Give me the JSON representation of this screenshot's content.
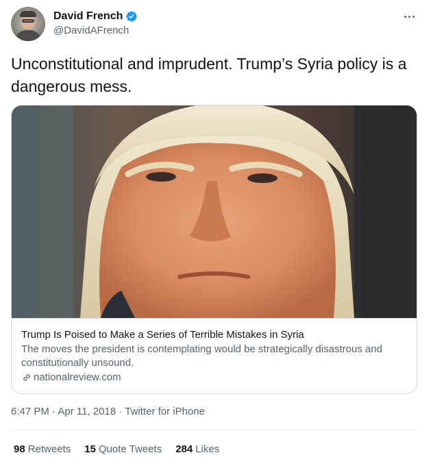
{
  "user": {
    "display_name": "David French",
    "handle": "@DavidAFrench",
    "verified_icon": "verified-badge-icon",
    "avatar_icon": "avatar-photo"
  },
  "tweet": {
    "text": "Unconstitutional and imprudent. Trump’s Syria policy is a dangerous mess."
  },
  "card": {
    "title": "Trump Is Poised to Make a Series of Terrible Mistakes in Syria",
    "description": "The moves the president is contemplating would be strategically disastrous and constitutionally unsound.",
    "domain": "nationalreview.com",
    "link_icon": "link-icon"
  },
  "meta": {
    "time": "6:47 PM",
    "date": "Apr 11, 2018",
    "source": "Twitter for iPhone",
    "separator": "·"
  },
  "stats": {
    "retweets_count": "98",
    "retweets_label": "Retweets",
    "quote_count": "15",
    "quote_label": "Quote Tweets",
    "likes_count": "284",
    "likes_label": "Likes"
  },
  "colors": {
    "text_primary": "#0f1419",
    "text_secondary": "#536471",
    "verified_blue": "#1d9bf0",
    "border": "#cfd9de"
  }
}
